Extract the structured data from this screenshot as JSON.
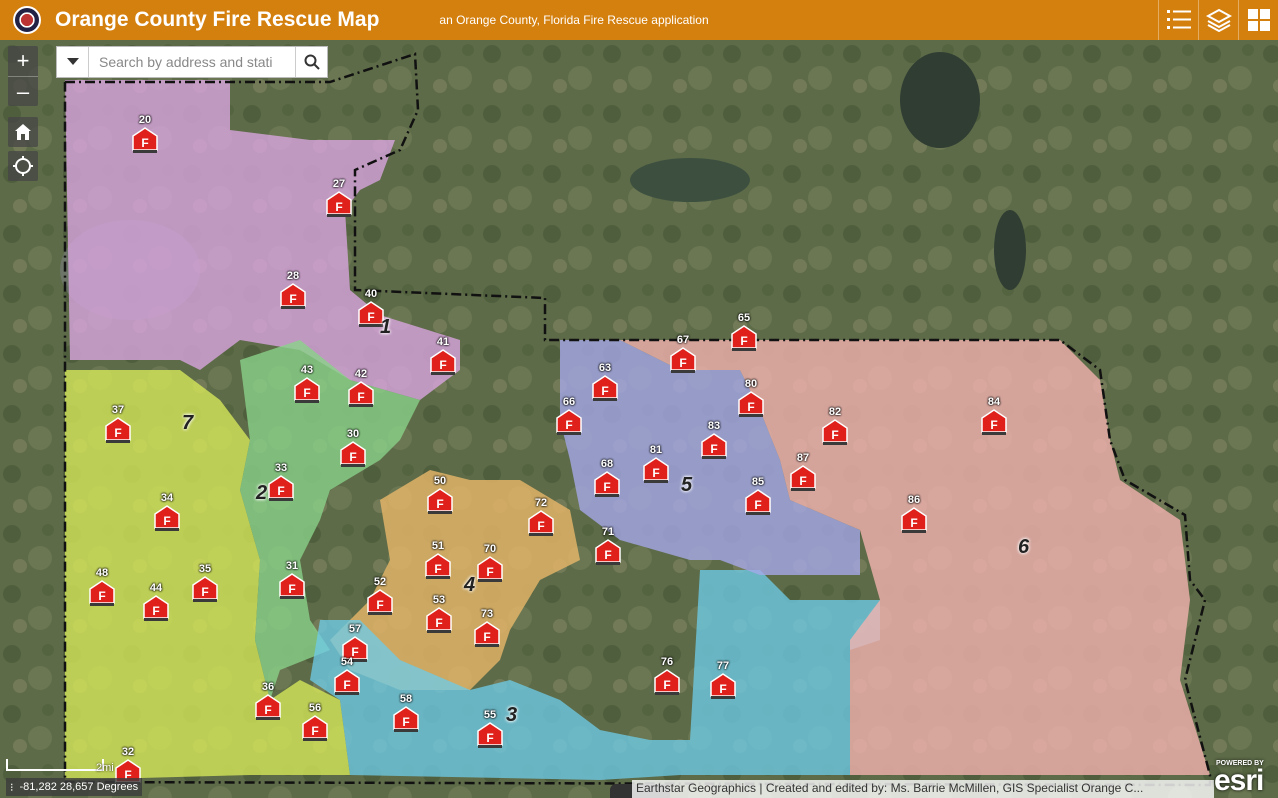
{
  "app": {
    "title": "Orange County Fire Rescue Map",
    "subtitle": "an Orange County, Florida Fire Rescue application"
  },
  "header_buttons": [
    {
      "name": "legend-list-icon"
    },
    {
      "name": "layers-icon"
    },
    {
      "name": "widgets-grid-icon"
    }
  ],
  "search": {
    "placeholder": "Search by address and stati"
  },
  "zoom": {
    "in_label": "+",
    "out_label": "–"
  },
  "colors": {
    "header": "#d4800f",
    "district_1": "#d9a5e0",
    "district_2": "#8ad28a",
    "district_3": "#6ecbe6",
    "district_4": "#e8b86a",
    "district_5": "#a7a9ea",
    "district_6": "#f2b3b0",
    "district_7": "#d9ea5a"
  },
  "districts": [
    "1",
    "2",
    "3",
    "4",
    "5",
    "6",
    "7"
  ],
  "stations": [
    "20",
    "27",
    "28",
    "40",
    "41",
    "43",
    "42",
    "37",
    "30",
    "33",
    "34",
    "48",
    "44",
    "35",
    "31",
    "36",
    "56",
    "32",
    "50",
    "51",
    "52",
    "53",
    "57",
    "54",
    "58",
    "55",
    "70",
    "72",
    "73",
    "63",
    "66",
    "68",
    "71",
    "81",
    "67",
    "65",
    "80",
    "83",
    "82",
    "84",
    "87",
    "85",
    "86",
    "76",
    "77"
  ],
  "scale": {
    "label": "2mi"
  },
  "coordinates": "-81,282 28,657 Degrees",
  "attribution": "Earthstar Geographics | Created and edited by: Ms. Barrie McMillen, GIS Specialist Orange C...",
  "esri": {
    "powered": "POWERED BY",
    "brand": "esri"
  }
}
